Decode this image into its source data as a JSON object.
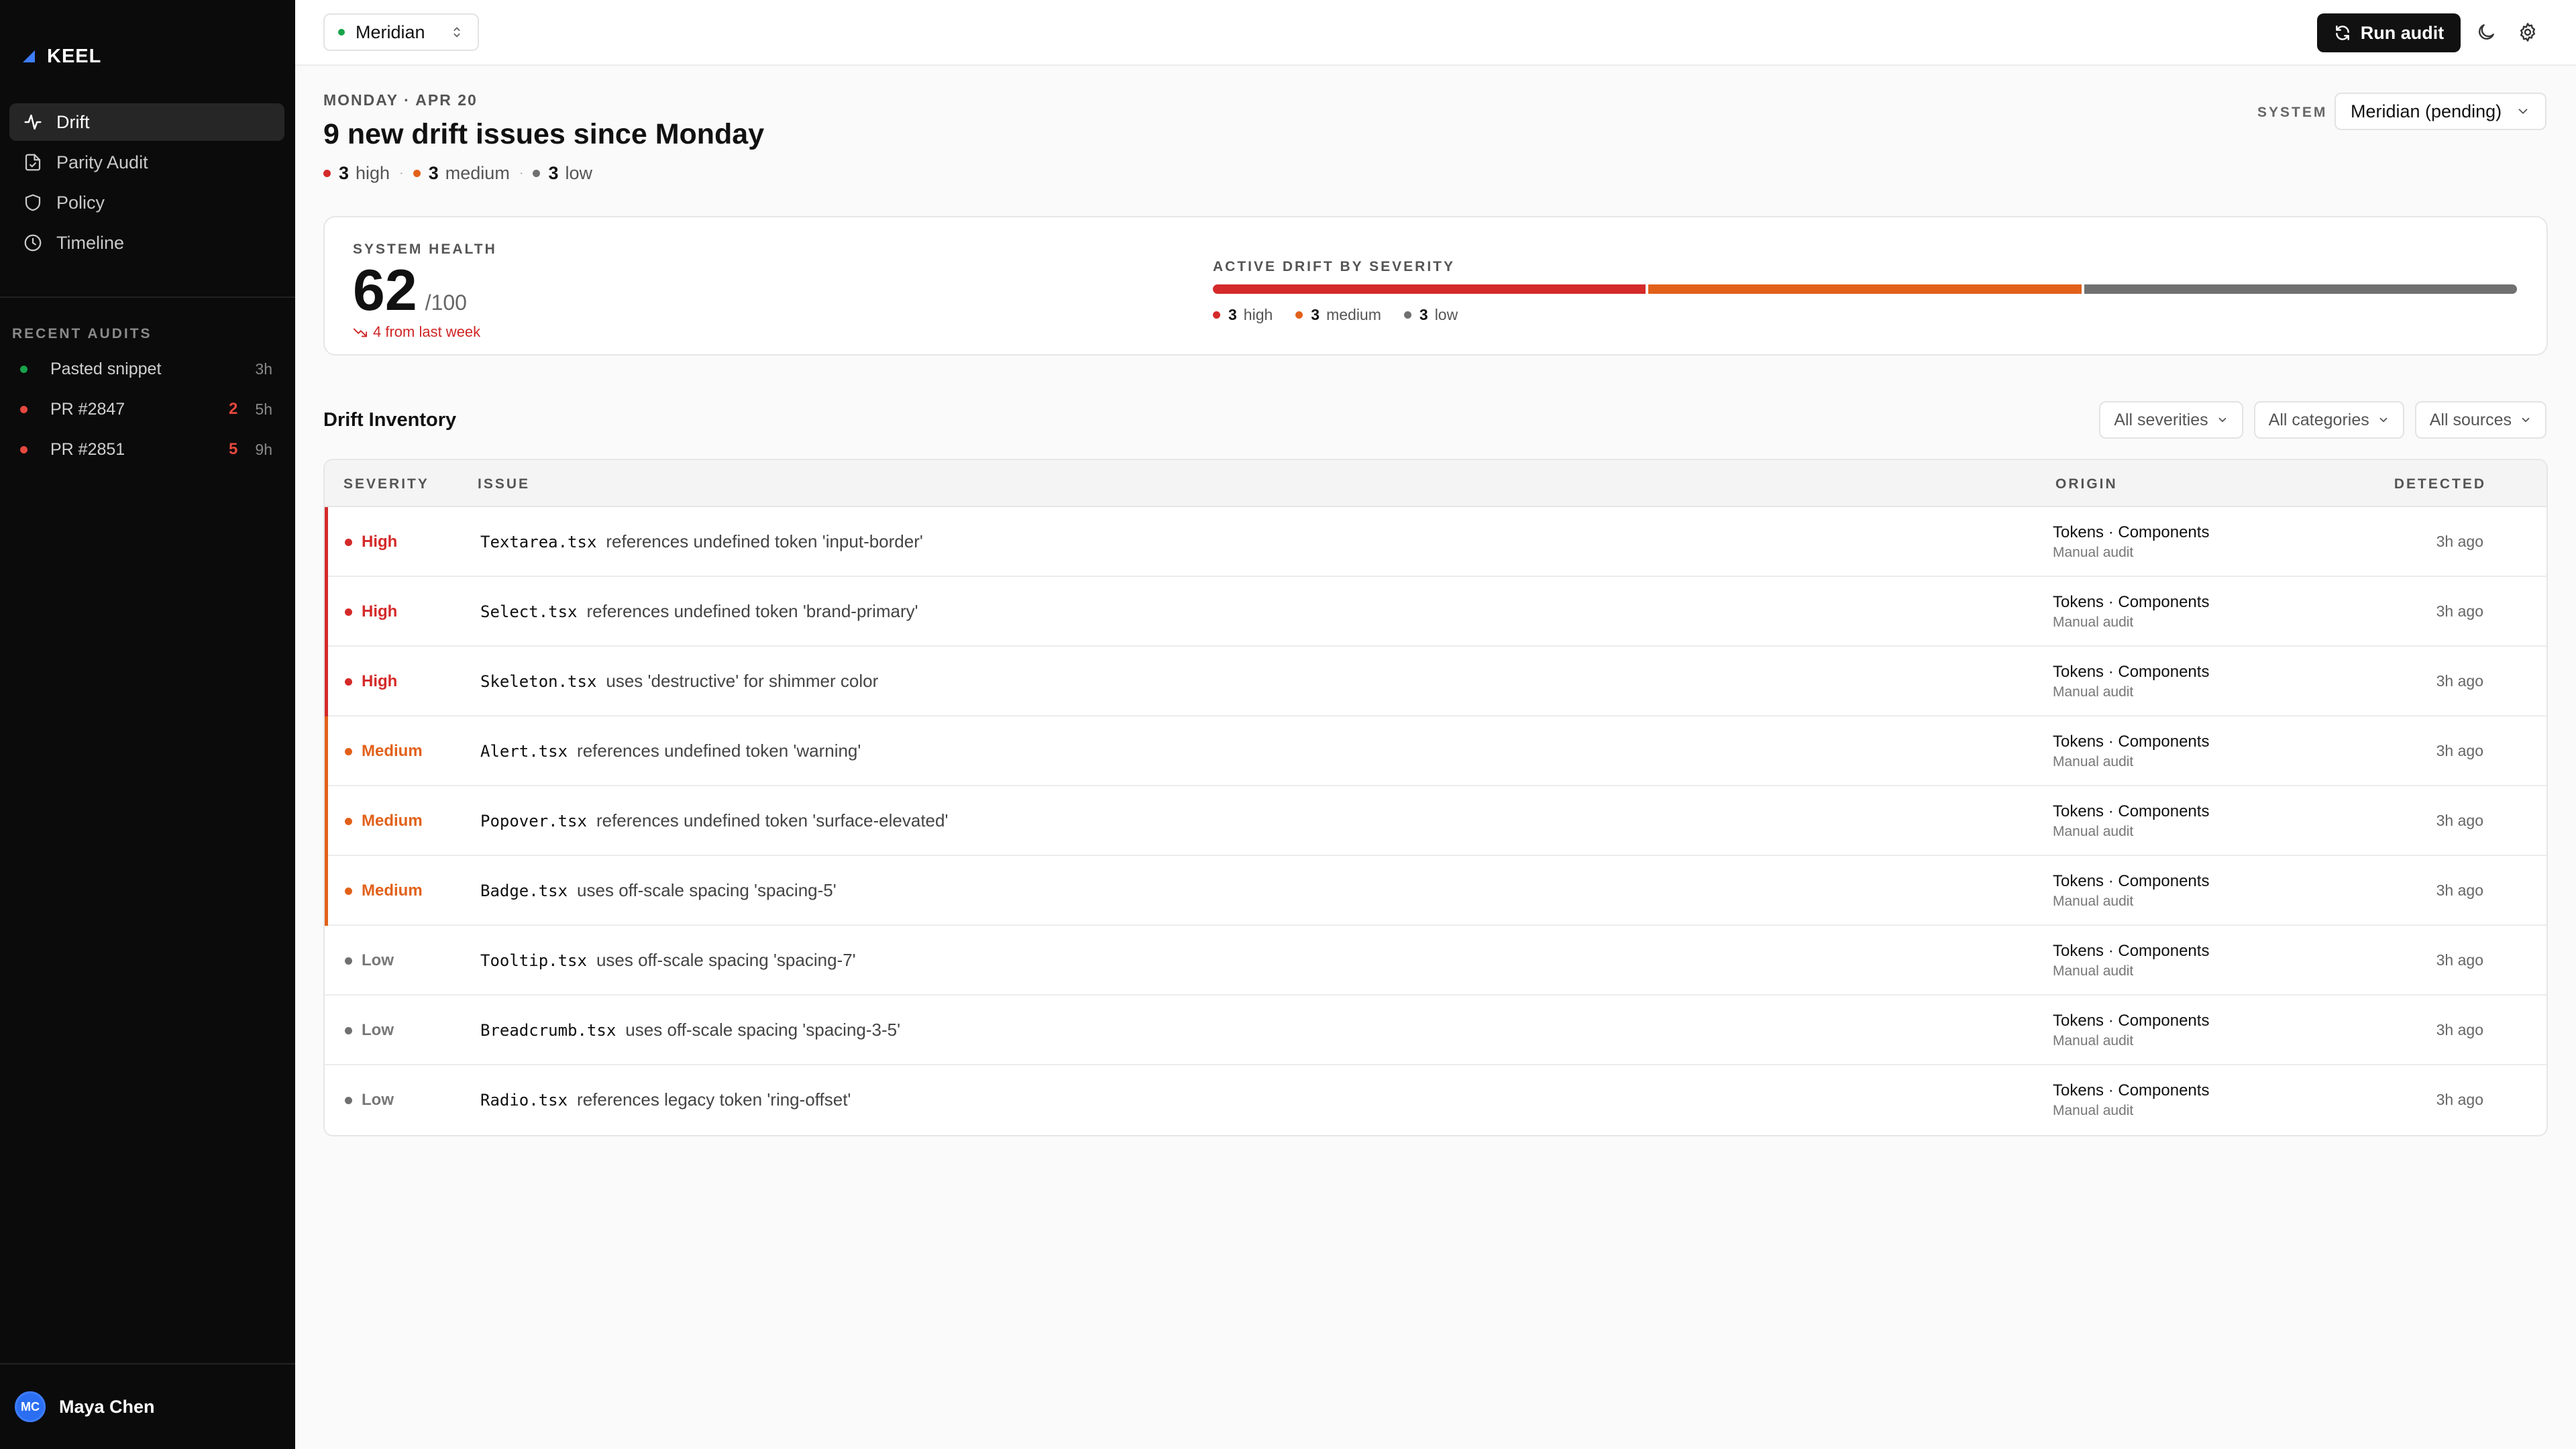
{
  "app": {
    "name": "KEEL"
  },
  "colors": {
    "high": "#d42a2a",
    "medium": "#e2611a",
    "low": "#707070",
    "accent": "#2b6ef2"
  },
  "nav": [
    {
      "label": "Drift",
      "icon": "activity-icon",
      "active": true
    },
    {
      "label": "Parity Audit",
      "icon": "file-check-icon",
      "active": false
    },
    {
      "label": "Policy",
      "icon": "shield-icon",
      "active": false
    },
    {
      "label": "Timeline",
      "icon": "clock-icon",
      "active": false
    }
  ],
  "recent": {
    "label": "RECENT AUDITS",
    "items": [
      {
        "label": "Pasted snippet",
        "count": "",
        "time": "3h",
        "status": "ok"
      },
      {
        "label": "PR #2847",
        "count": "2",
        "time": "5h",
        "status": "issues"
      },
      {
        "label": "PR #2851",
        "count": "5",
        "time": "9h",
        "status": "issues"
      }
    ]
  },
  "user": {
    "initials": "MC",
    "name": "Maya Chen"
  },
  "topbar": {
    "system": "Meridian",
    "run_label": "Run audit"
  },
  "header": {
    "date": "MONDAY · APR 20",
    "title": "9 new drift issues since Monday",
    "summary": {
      "high": "3",
      "high_label": "high",
      "medium": "3",
      "medium_label": "medium",
      "low": "3",
      "low_label": "low"
    },
    "system_label": "SYSTEM",
    "system_value": "Meridian (pending)"
  },
  "health": {
    "label": "SYSTEM HEALTH",
    "score": "62",
    "max": "/100",
    "delta": "4 from last week",
    "bar_label": "ACTIVE DRIFT BY SEVERITY",
    "bar": [
      {
        "name": "high",
        "count": "3",
        "value": 3,
        "color": "#d42a2a"
      },
      {
        "name": "medium",
        "count": "3",
        "value": 3,
        "color": "#e2611a"
      },
      {
        "name": "low",
        "count": "3",
        "value": 3,
        "color": "#707070"
      }
    ]
  },
  "inventory": {
    "title": "Drift Inventory",
    "filters": [
      "All severities",
      "All categories",
      "All sources"
    ],
    "columns": {
      "severity": "SEVERITY",
      "issue": "ISSUE",
      "origin": "ORIGIN",
      "detected": "DETECTED"
    },
    "rows": [
      {
        "severity": "High",
        "level": "high",
        "file": "Textarea.tsx",
        "desc": "references undefined token 'input-border'",
        "origin": "Tokens · Components",
        "source": "Manual audit",
        "detected": "3h ago"
      },
      {
        "severity": "High",
        "level": "high",
        "file": "Select.tsx",
        "desc": "references undefined token 'brand-primary'",
        "origin": "Tokens · Components",
        "source": "Manual audit",
        "detected": "3h ago"
      },
      {
        "severity": "High",
        "level": "high",
        "file": "Skeleton.tsx",
        "desc": "uses 'destructive' for shimmer color",
        "origin": "Tokens · Components",
        "source": "Manual audit",
        "detected": "3h ago"
      },
      {
        "severity": "Medium",
        "level": "medium",
        "file": "Alert.tsx",
        "desc": "references undefined token 'warning'",
        "origin": "Tokens · Components",
        "source": "Manual audit",
        "detected": "3h ago"
      },
      {
        "severity": "Medium",
        "level": "medium",
        "file": "Popover.tsx",
        "desc": "references undefined token 'surface-elevated'",
        "origin": "Tokens · Components",
        "source": "Manual audit",
        "detected": "3h ago"
      },
      {
        "severity": "Medium",
        "level": "medium",
        "file": "Badge.tsx",
        "desc": "uses off-scale spacing 'spacing-5'",
        "origin": "Tokens · Components",
        "source": "Manual audit",
        "detected": "3h ago"
      },
      {
        "severity": "Low",
        "level": "low",
        "file": "Tooltip.tsx",
        "desc": "uses off-scale spacing 'spacing-7'",
        "origin": "Tokens · Components",
        "source": "Manual audit",
        "detected": "3h ago"
      },
      {
        "severity": "Low",
        "level": "low",
        "file": "Breadcrumb.tsx",
        "desc": "uses off-scale spacing 'spacing-3-5'",
        "origin": "Tokens · Components",
        "source": "Manual audit",
        "detected": "3h ago"
      },
      {
        "severity": "Low",
        "level": "low",
        "file": "Radio.tsx",
        "desc": "references legacy token 'ring-offset'",
        "origin": "Tokens · Components",
        "source": "Manual audit",
        "detected": "3h ago"
      }
    ]
  }
}
